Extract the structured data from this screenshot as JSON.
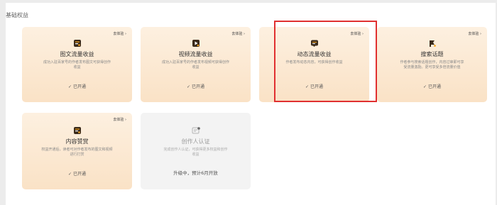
{
  "section": {
    "title": "基础权益"
  },
  "more_label": "去体验",
  "more_arrow": "›",
  "check_mark": "✓",
  "cards": [
    {
      "title": "图文流量收益",
      "desc": "成功入驻百家号的作者发布图文可获得创作收益",
      "status": "已开通",
      "more": "去体验",
      "icon": "article-icon"
    },
    {
      "title": "视频流量收益",
      "desc": "成功入驻百家号的作者发布视频可获得创作收益",
      "status": "已开通",
      "more": "去体验",
      "icon": "video-icon"
    },
    {
      "title": "动态流量收益",
      "desc": "作者发布动态内容，可获得创作收益",
      "status": "已开通",
      "more": "去体验",
      "icon": "dynamic-icon"
    },
    {
      "title": "搜索话题",
      "desc": "作者参与搜索话题创作，内容过审即可享受流量激励。更可享受多倍流量价值",
      "status": "已开通",
      "more": "去体验",
      "icon": "search-topic-icon"
    },
    {
      "title": "内容赞赏",
      "desc": "权益开通后，读者可对作者发布的图文和视频进行打赏",
      "status": "已开通",
      "more": "去体验",
      "icon": "reward-icon"
    },
    {
      "title": "创作人认证",
      "desc": "完成创作人认证，可获得更多权益和创作收益",
      "status": "升级中，预计6月开放",
      "icon": "certification-icon"
    }
  ],
  "colors": {
    "card_bg_top": "#fdf0e0",
    "card_bg_bottom": "#fae2c6",
    "highlight": "#e03030"
  }
}
